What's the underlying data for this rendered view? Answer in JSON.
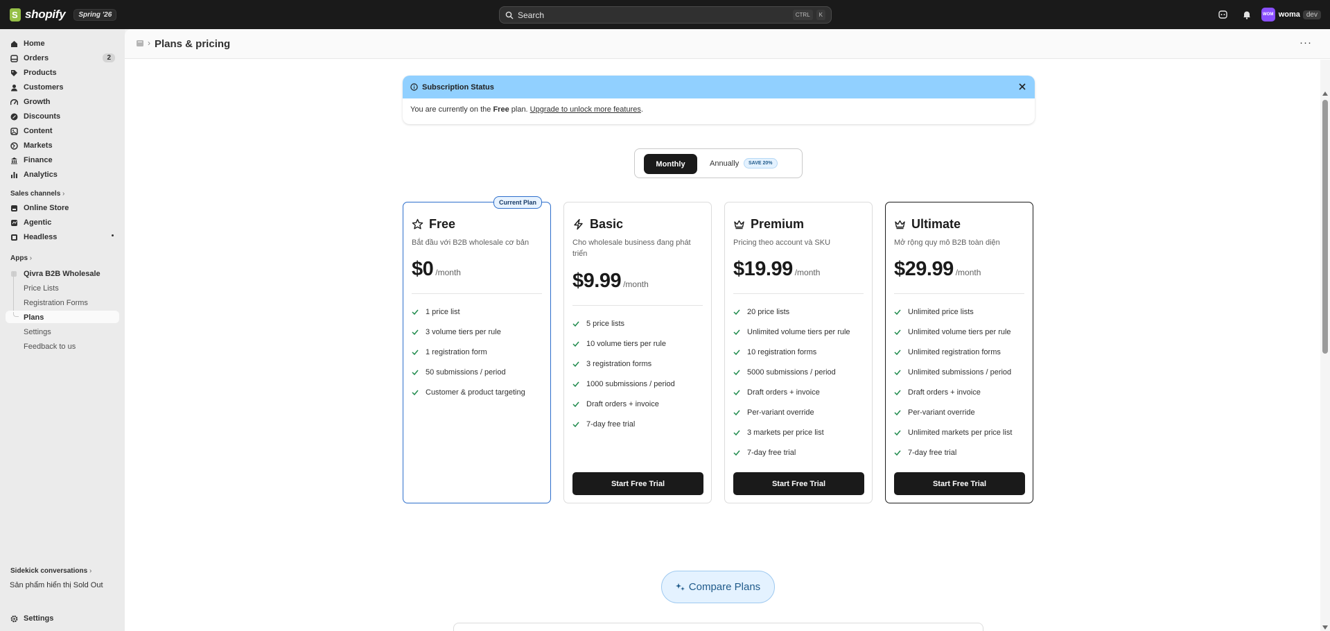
{
  "topbar": {
    "logo_text": "shopify",
    "version": "Spring '26",
    "search_placeholder": "Search",
    "kbd": [
      "CTRL",
      "K"
    ],
    "avatar_initials": "WOM",
    "store_name": "woma",
    "env": "dev"
  },
  "sidebar": {
    "main_items": [
      {
        "label": "Home",
        "icon": "home-icon"
      },
      {
        "label": "Orders",
        "icon": "orders-icon",
        "badge": "2"
      },
      {
        "label": "Products",
        "icon": "tag-icon"
      },
      {
        "label": "Customers",
        "icon": "person-icon"
      },
      {
        "label": "Growth",
        "icon": "growth-icon"
      },
      {
        "label": "Discounts",
        "icon": "discount-icon"
      },
      {
        "label": "Content",
        "icon": "content-icon"
      },
      {
        "label": "Markets",
        "icon": "globe-icon"
      },
      {
        "label": "Finance",
        "icon": "bank-icon"
      },
      {
        "label": "Analytics",
        "icon": "chart-icon"
      }
    ],
    "sales_channels_label": "Sales channels",
    "channels": [
      {
        "label": "Online Store",
        "icon": "store-icon"
      },
      {
        "label": "Agentic",
        "icon": "agentic-icon"
      },
      {
        "label": "Headless",
        "icon": "headless-icon"
      }
    ],
    "apps_label": "Apps",
    "app_name": "Qivra B2B Wholesale",
    "app_items": [
      "Price Lists",
      "Registration Forms",
      "Plans",
      "Settings",
      "Feedback to us"
    ],
    "sidekick_label": "Sidekick conversations",
    "sidekick_item": "Sản phẩm hiển thị Sold Out",
    "settings_label": "Settings"
  },
  "page": {
    "title": "Plans & pricing"
  },
  "banner": {
    "title": "Subscription Status",
    "text_before": "You are currently on the ",
    "plan": "Free",
    "text_after": " plan. ",
    "link": "Upgrade to unlock more features",
    "period": "."
  },
  "billing_toggle": {
    "monthly": "Monthly",
    "annually": "Annually",
    "save_badge": "SAVE 20%",
    "selected": "Monthly"
  },
  "plans": [
    {
      "name": "Free",
      "icon": "star-icon",
      "desc": "Bắt đầu với B2B wholesale cơ bản",
      "price": "$0",
      "per": "/month",
      "current": true,
      "badge": "Current Plan",
      "features": [
        "1 price list",
        "3 volume tiers per rule",
        "1 registration form",
        "50 submissions / period",
        "Customer & product targeting"
      ]
    },
    {
      "name": "Basic",
      "icon": "lightning-icon",
      "desc": "Cho wholesale business đang phát triển",
      "price": "$9.99",
      "per": "/month",
      "features": [
        "5 price lists",
        "10 volume tiers per rule",
        "3 registration forms",
        "1000 submissions / period",
        "Draft orders + invoice",
        "7-day free trial"
      ],
      "cta": "Start Free Trial"
    },
    {
      "name": "Premium",
      "icon": "crown-icon",
      "desc": "Pricing theo account và SKU",
      "price": "$19.99",
      "per": "/month",
      "features": [
        "20 price lists",
        "Unlimited volume tiers per rule",
        "10 registration forms",
        "5000 submissions / period",
        "Draft orders + invoice",
        "Per-variant override",
        "3 markets per price list",
        "7-day free trial"
      ],
      "cta": "Start Free Trial"
    },
    {
      "name": "Ultimate",
      "icon": "crown-icon",
      "desc": "Mở rộng quy mô B2B toàn diện",
      "price": "$29.99",
      "per": "/month",
      "features": [
        "Unlimited price lists",
        "Unlimited volume tiers per rule",
        "Unlimited registration forms",
        "Unlimited submissions / period",
        "Draft orders + invoice",
        "Per-variant override",
        "Unlimited markets per price list",
        "7-day free trial"
      ],
      "cta": "Start Free Trial"
    }
  ],
  "compare_button": "Compare Plans",
  "colors": {
    "banner_bg": "#91d0ff",
    "primary_dark": "#1a1a1a",
    "current_border": "#2c6ecb",
    "check_green": "#1f8a4c"
  }
}
